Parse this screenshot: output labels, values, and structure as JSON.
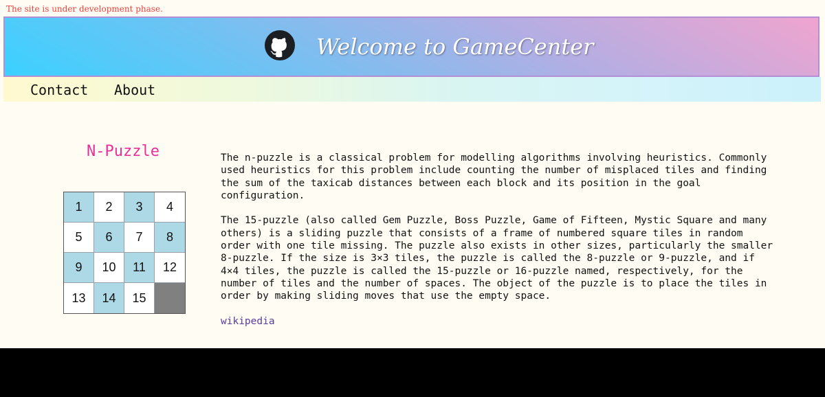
{
  "notice": "The site is under development phase.",
  "header": {
    "title": "Welcome to GameCenter",
    "icon": "github-icon"
  },
  "nav": {
    "items": [
      {
        "label": "Contact"
      },
      {
        "label": "About"
      }
    ]
  },
  "puzzle": {
    "title": "N-Puzzle",
    "tiles": [
      "1",
      "2",
      "3",
      "4",
      "5",
      "6",
      "7",
      "8",
      "9",
      "10",
      "11",
      "12",
      "13",
      "14",
      "15",
      ""
    ],
    "tile_colors": {
      "blue": "#add8e6",
      "white": "#ffffff",
      "empty": "#808080"
    }
  },
  "description": {
    "paragraphs": [
      "The n-puzzle is a classical problem for modelling algorithms involving heuristics. Commonly used heuristics for this problem include counting the number of misplaced tiles and finding the sum of the taxicab distances between each block and its position in the goal configuration.",
      "The 15-puzzle (also called Gem Puzzle, Boss Puzzle, Game of Fifteen, Mystic Square and many others) is a sliding puzzle that consists of a frame of numbered square tiles in random order with one tile missing. The puzzle also exists in other sizes, particularly the smaller 8-puzzle. If the size is 3×3 tiles, the puzzle is called the 8-puzzle or 9-puzzle, and if 4×4 tiles, the puzzle is called the 15-puzzle or 16-puzzle named, respectively, for the number of tiles and the number of spaces. The object of the puzzle is to place the tiles in order by making sliding moves that use the empty space."
    ],
    "link_label": "wikipedia"
  }
}
